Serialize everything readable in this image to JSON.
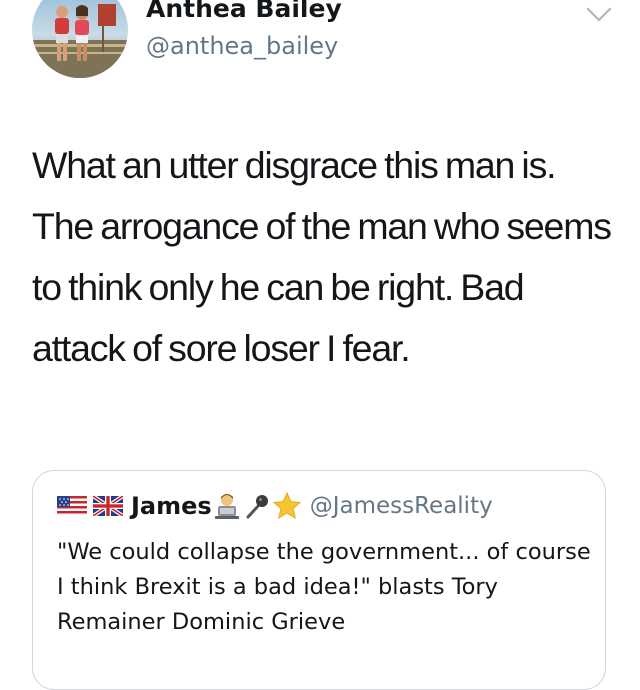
{
  "author": {
    "display_name": "Anthea Bailey",
    "handle": "@anthea_bailey",
    "avatar_icon": "avatar-photo"
  },
  "tweet": {
    "text": "What an utter disgrace this man is. The arrogance of the man who seems to think only he can be right. Bad attack of sore loser I fear."
  },
  "quoted_tweet": {
    "display_name": "James",
    "handle": "@JamessReality",
    "name_emojis": [
      "us-flag-icon",
      "uk-flag-icon",
      "technologist-icon",
      "microphone-icon",
      "star-icon"
    ],
    "text": "\"We could collapse the government... of course I think Brexit is a bad idea!\" blasts Tory Remainer Dominic Grieve"
  },
  "colors": {
    "text": "#14171a",
    "secondary": "#657786",
    "border": "#ccd6dd"
  }
}
